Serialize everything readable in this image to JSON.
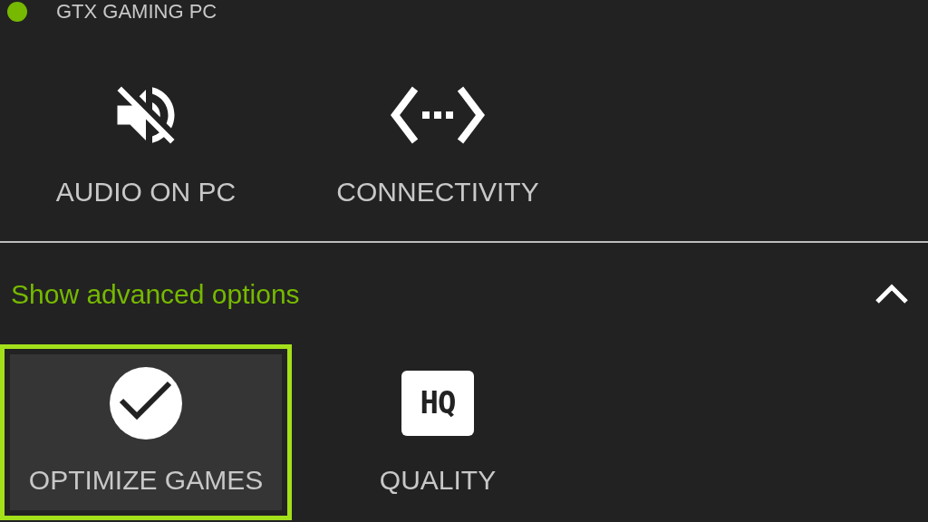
{
  "device": {
    "name": "GTX GAMING PC",
    "online": true
  },
  "tiles": [
    {
      "kind": "audio_off",
      "label": "AUDIO ON PC",
      "selected": false
    },
    {
      "kind": "connectivity",
      "label": "CONNECTIVITY",
      "selected": false
    }
  ],
  "advanced": {
    "label": "Show advanced options",
    "expanded": true
  },
  "advanced_tiles": [
    {
      "kind": "optimize",
      "label": "OPTIMIZE GAMES",
      "selected": true
    },
    {
      "kind": "quality",
      "label": "QUALITY",
      "badge": "HQ",
      "selected": false
    }
  ]
}
